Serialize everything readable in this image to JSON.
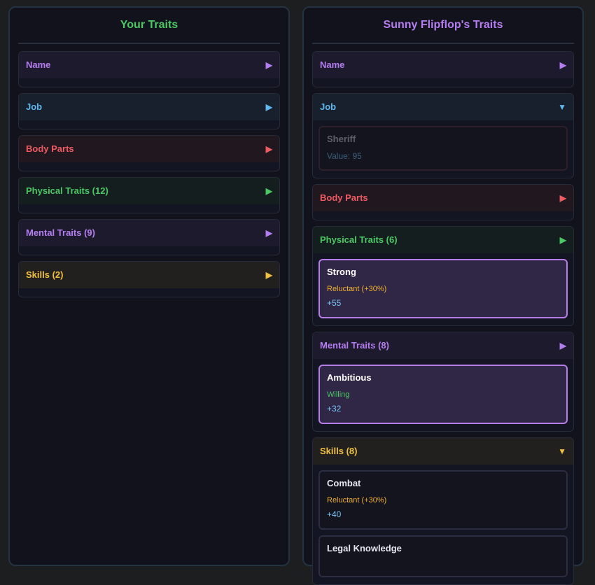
{
  "left_panel": {
    "title": "Your Traits",
    "categories": [
      {
        "label": "Name",
        "arrow": "▶"
      },
      {
        "label": "Job",
        "arrow": "▶"
      },
      {
        "label": "Body Parts",
        "arrow": "▶"
      },
      {
        "label": "Physical Traits (12)",
        "arrow": "▶"
      },
      {
        "label": "Mental Traits (9)",
        "arrow": "▶"
      },
      {
        "label": "Skills (2)",
        "arrow": "▶"
      }
    ]
  },
  "right_panel": {
    "title": "Sunny Flipflop's Traits",
    "categories": [
      {
        "label": "Name",
        "arrow": "▶"
      },
      {
        "label": "Job",
        "arrow": "▼",
        "items": [
          {
            "title": "Sheriff",
            "value": "Value: 95"
          }
        ]
      },
      {
        "label": "Body Parts",
        "arrow": "▶"
      },
      {
        "label": "Physical Traits (6)",
        "arrow": "▶",
        "items": [
          {
            "title": "Strong",
            "attitude": "Reluctant (+30%)",
            "value": "+55"
          }
        ]
      },
      {
        "label": "Mental Traits (8)",
        "arrow": "▶",
        "items": [
          {
            "title": "Ambitious",
            "attitude": "Willing",
            "value": "+32"
          }
        ]
      },
      {
        "label": "Skills (8)",
        "arrow": "▼",
        "items": [
          {
            "title": "Combat",
            "attitude": "Reluctant (+30%)",
            "value": "+40"
          },
          {
            "title": "Legal Knowledge"
          }
        ]
      }
    ]
  },
  "colors": {
    "title_left": "#4cc865",
    "title_right": "#b57ef0",
    "reluctant": "#f0b030",
    "willing": "#4cc865"
  }
}
